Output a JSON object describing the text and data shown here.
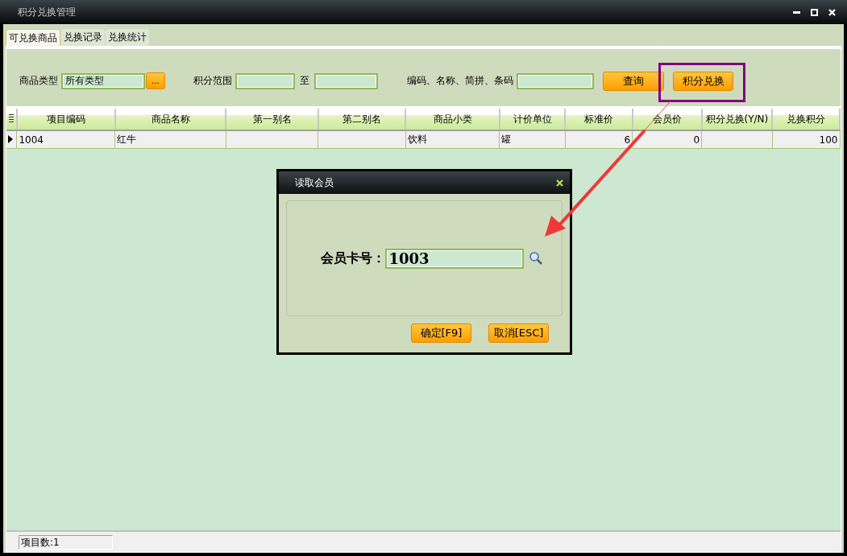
{
  "window": {
    "title": "积分兑换管理"
  },
  "tabs": [
    {
      "label": "可兑换商品",
      "selected": true
    },
    {
      "label": "兑换记录",
      "selected": false
    },
    {
      "label": "兑换统计",
      "selected": false
    }
  ],
  "filters": {
    "category": {
      "label": "商品类型",
      "value": "所有类型",
      "button": "..."
    },
    "points_range": {
      "label": "积分范围",
      "separator": "至"
    },
    "keyword": {
      "label": "编码、名称、简拼、条码"
    },
    "buttons": [
      "查询",
      "积分兑换"
    ]
  },
  "table": {
    "columns": [
      {
        "label": "项目编码",
        "kind": "text"
      },
      {
        "label": "商品名称",
        "kind": "text"
      },
      {
        "label": "第一别名",
        "kind": "text"
      },
      {
        "label": "第二别名",
        "kind": "text"
      },
      {
        "label": "商品小类",
        "kind": "text"
      },
      {
        "label": "计价单位",
        "kind": "text"
      },
      {
        "label": "标准价",
        "kind": "number"
      },
      {
        "label": "会员价",
        "kind": "number"
      },
      {
        "label": "积分兑换(Y/N)",
        "kind": "text"
      },
      {
        "label": "兑换积分",
        "kind": "number"
      }
    ],
    "rows": [
      {
        "selected": true,
        "cells": [
          "1004",
          "红牛",
          null,
          null,
          "饮料",
          "罐",
          "6",
          "0",
          null,
          "100"
        ]
      }
    ]
  },
  "status_bar": {
    "item_count": "项目数:1"
  },
  "dialog": {
    "title": "读取会员",
    "field": {
      "label": "会员卡号：",
      "value": "1003"
    },
    "buttons": [
      "确定[F9]",
      "取消[ESC]"
    ]
  }
}
